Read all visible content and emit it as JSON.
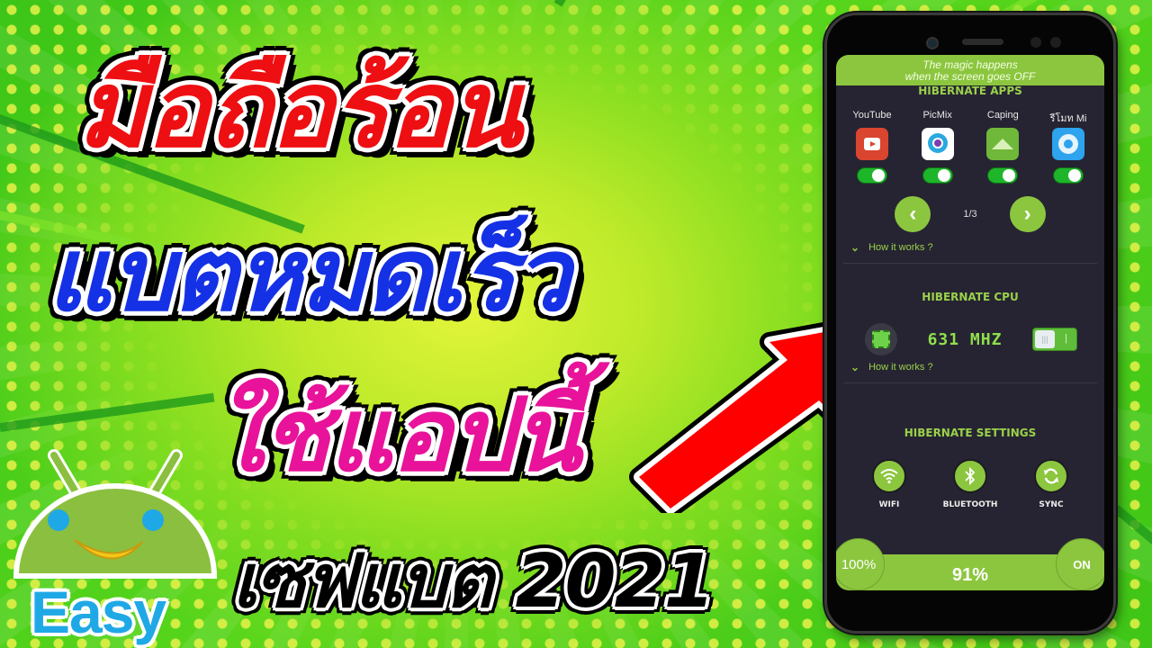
{
  "thumbnail": {
    "headline_lines": [
      {
        "text": "มือถือร้อน",
        "color": "#ee0f12"
      },
      {
        "text": "แบตหมดเร็ว",
        "color": "#1531e6"
      },
      {
        "text": "ใช้แอปนี้",
        "color": "#e8139a"
      },
      {
        "text": "เซฟแบต 2021",
        "color": "#000000"
      }
    ],
    "logo": {
      "brand_text": "Easy",
      "brand_color": "#1fa8e6",
      "mascot": "android-banana-mascot"
    },
    "arrow": {
      "color": "#ff0000",
      "direction": "up-right"
    }
  },
  "phone_app": {
    "banner": {
      "line1": "The magic happens",
      "line2": "when the screen goes OFF"
    },
    "accent_color": "#8cc63f",
    "hibernate_apps": {
      "title": "HIBERNATE APPS",
      "apps": [
        {
          "name": "YouTube",
          "icon": "youtube-icon",
          "enabled": true,
          "color": "#d9452e"
        },
        {
          "name": "PicMix",
          "icon": "picmix-icon",
          "enabled": true,
          "color": "#ffffff"
        },
        {
          "name": "Caping",
          "icon": "caping-icon",
          "enabled": true,
          "color": "#6fb83a"
        },
        {
          "name": "รีโมท Mi",
          "icon": "mi-remote-icon",
          "enabled": true,
          "color": "#2ea3ee"
        }
      ],
      "prev_label": "‹",
      "next_label": "›",
      "page": "1/3",
      "how_it_works": "How it works ?"
    },
    "hibernate_cpu": {
      "title": "HIBERNATE CPU",
      "frequency": "631 MHZ",
      "switch_on": true,
      "how_it_works": "How it works ?"
    },
    "hibernate_settings": {
      "title": "HIBERNATE SETTINGS",
      "items": [
        {
          "label": "WIFI",
          "icon": "wifi-icon"
        },
        {
          "label": "BLUETOOTH",
          "icon": "bluetooth-icon"
        },
        {
          "label": "SYNC",
          "icon": "sync-icon"
        }
      ]
    },
    "battery": {
      "left_label": "100%",
      "current": "91%",
      "right_label": "ON"
    }
  }
}
